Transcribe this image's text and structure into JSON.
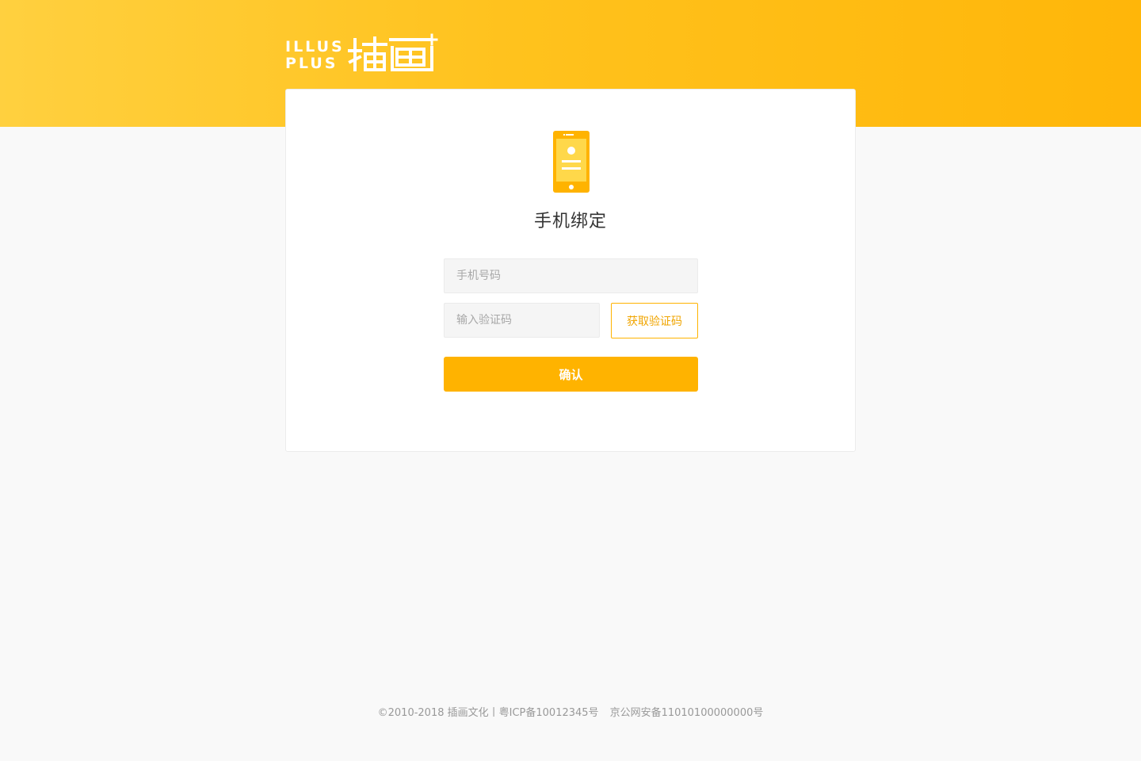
{
  "logo": {
    "latin_line1": "ILLUS",
    "latin_line2": "PLUS",
    "chinese_text": "插画+"
  },
  "page": {
    "icon": "smartphone-icon",
    "title": "手机绑定"
  },
  "form": {
    "phone_placeholder": "手机号码",
    "code_placeholder": "输入验证码",
    "get_code_label": "获取验证码",
    "confirm_label": "确认"
  },
  "footer": {
    "copyright": "©2010-2018 插画文化丨粤ICP备10012345号",
    "police_record": "京公网安备11010100000000号"
  },
  "colors": {
    "accent": "#ffb300",
    "banner_start": "#ffd03f",
    "banner_end": "#ffb609"
  }
}
